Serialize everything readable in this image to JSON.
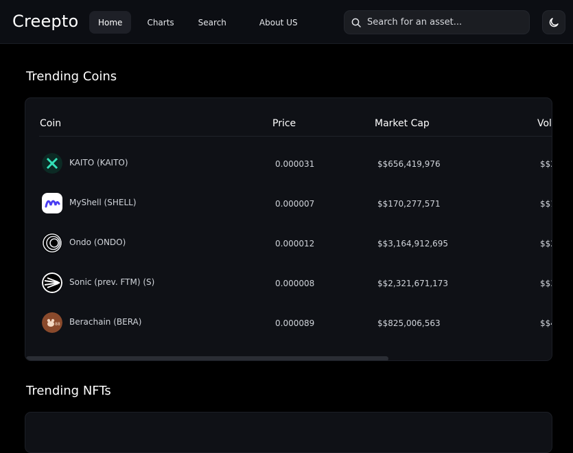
{
  "app": {
    "name": "Creepto"
  },
  "nav": {
    "links": [
      {
        "label": "Home",
        "active": true
      },
      {
        "label": "Charts",
        "active": false
      },
      {
        "label": "Search",
        "active": false
      },
      {
        "label": "About US",
        "active": false
      }
    ]
  },
  "search": {
    "placeholder": "Search for an asset...",
    "value": "",
    "icon": "search-icon"
  },
  "theme_toggle": {
    "icon": "moon-icon"
  },
  "trending_coins": {
    "title": "Trending Coins",
    "columns": [
      "Coin",
      "Price",
      "Market Cap",
      "Vol"
    ],
    "rows": [
      {
        "coin": "KAITO (KAITO)",
        "price": "0.000031",
        "market_cap": "$$656,419,976",
        "volume": "$$2",
        "icon": "kaito-logo"
      },
      {
        "coin": "MyShell (SHELL)",
        "price": "0.000007",
        "market_cap": "$$170,277,571",
        "volume": "$$1",
        "icon": "myshell-logo"
      },
      {
        "coin": "Ondo (ONDO)",
        "price": "0.000012",
        "market_cap": "$$3,164,912,695",
        "volume": "$$2",
        "icon": "ondo-logo"
      },
      {
        "coin": "Sonic (prev. FTM) (S)",
        "price": "0.000008",
        "market_cap": "$$2,321,671,173",
        "volume": "$$3",
        "icon": "sonic-logo"
      },
      {
        "coin": "Berachain (BERA)",
        "price": "0.000089",
        "market_cap": "$$825,006,563",
        "volume": "$$4",
        "icon": "berachain-logo"
      }
    ]
  },
  "trending_nfts": {
    "title": "Trending NFTs"
  },
  "colors": {
    "background": "#000000",
    "surface": "#0f1116",
    "navbar": "#0c0e13",
    "text": "#ffffff"
  }
}
